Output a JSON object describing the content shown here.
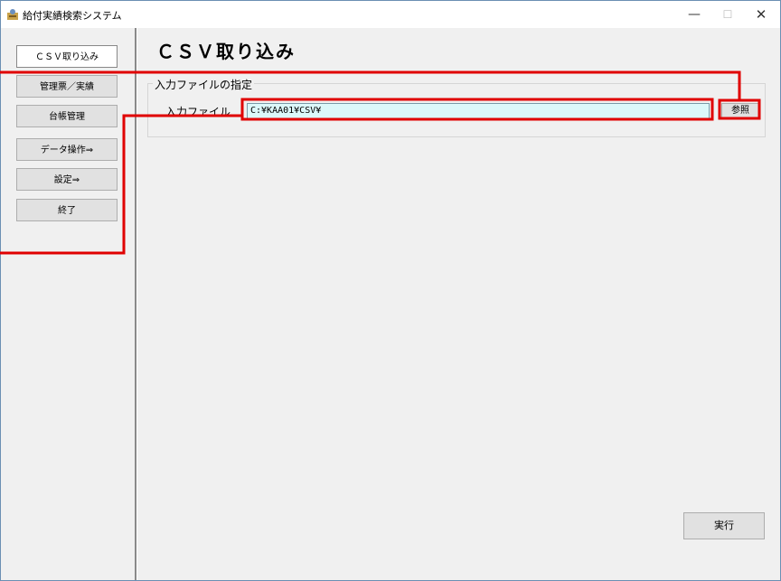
{
  "window": {
    "title": "給付実績検索システム",
    "minimize_glyph": "—",
    "maximize_glyph": "☐",
    "close_glyph": "✕"
  },
  "sidebar": {
    "items": [
      {
        "label": "ＣＳＶ取り込み"
      },
      {
        "label": "管理票／実績"
      },
      {
        "label": "台帳管理"
      },
      {
        "label": "データ操作⇒"
      },
      {
        "label": "設定⇒"
      },
      {
        "label": "終了"
      }
    ],
    "active_index": 0
  },
  "main": {
    "title": "ＣＳＶ取り込み",
    "group_label": "入力ファイルの指定",
    "input_label": "入力ファイル",
    "input_value": "C:¥KAA01¥CSV¥",
    "browse_label": "参照",
    "run_label": "実行"
  },
  "icons": {
    "app": "app-icon"
  },
  "colors": {
    "annotation": "#e00000",
    "input_background": "#dcf8fa"
  }
}
